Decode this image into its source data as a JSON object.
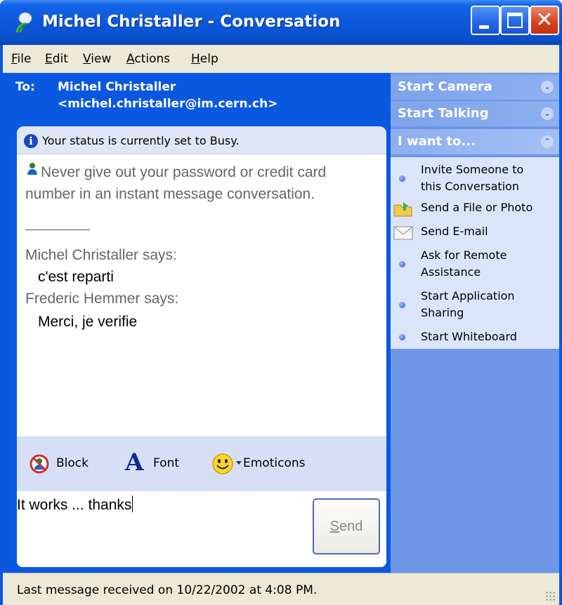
{
  "window": {
    "title": "Michel Christaller - Conversation"
  },
  "menu": {
    "items": [
      {
        "label": "File",
        "mnemonic": "F"
      },
      {
        "label": "Edit",
        "mnemonic": "E"
      },
      {
        "label": "View",
        "mnemonic": "V"
      },
      {
        "label": "Actions",
        "mnemonic": "A"
      },
      {
        "label": "Help",
        "mnemonic": "H"
      }
    ]
  },
  "recipient": {
    "label": "To:",
    "name": "Michel Christaller",
    "email": "<michel.christaller@im.cern.ch>"
  },
  "history": {
    "status_notice": "Your status is currently set to Busy.",
    "warning": "Never give out your password or credit card number in an instant message conversation.",
    "messages": [
      {
        "sender": "Michel Christaller says:",
        "text": "c'est reparti"
      },
      {
        "sender": "Frederic Hemmer says:",
        "text": "Merci, je verifie"
      }
    ]
  },
  "toolbar": {
    "block_label": "Block",
    "font_label": "Font",
    "font_glyph": "A",
    "emoticons_label": "Emoticons"
  },
  "compose": {
    "value": "It works ... thanks",
    "send_label_pre": "",
    "send_label_mnemonic": "S",
    "send_label_post": "end"
  },
  "panel": {
    "start_camera": "Start Camera",
    "start_talking": "Start Talking",
    "i_want_to": "I want to...",
    "tasks": [
      {
        "line1": "Invite Someone to",
        "line2": "this Conversation",
        "icon": "bullet"
      },
      {
        "line1": "Send a File or Photo",
        "line2": "",
        "icon": "folder-icon"
      },
      {
        "line1": "Send E-mail",
        "line2": "",
        "icon": "envelope-icon"
      },
      {
        "line1": "Ask for Remote",
        "line2": "Assistance",
        "icon": "bullet"
      },
      {
        "line1": "Start Application",
        "line2": "Sharing",
        "icon": "bullet"
      },
      {
        "line1": "Start Whiteboard",
        "line2": "",
        "icon": "bullet"
      }
    ]
  },
  "statusbar": {
    "text": "Last message received on 10/22/2002 at 4:08 PM."
  }
}
